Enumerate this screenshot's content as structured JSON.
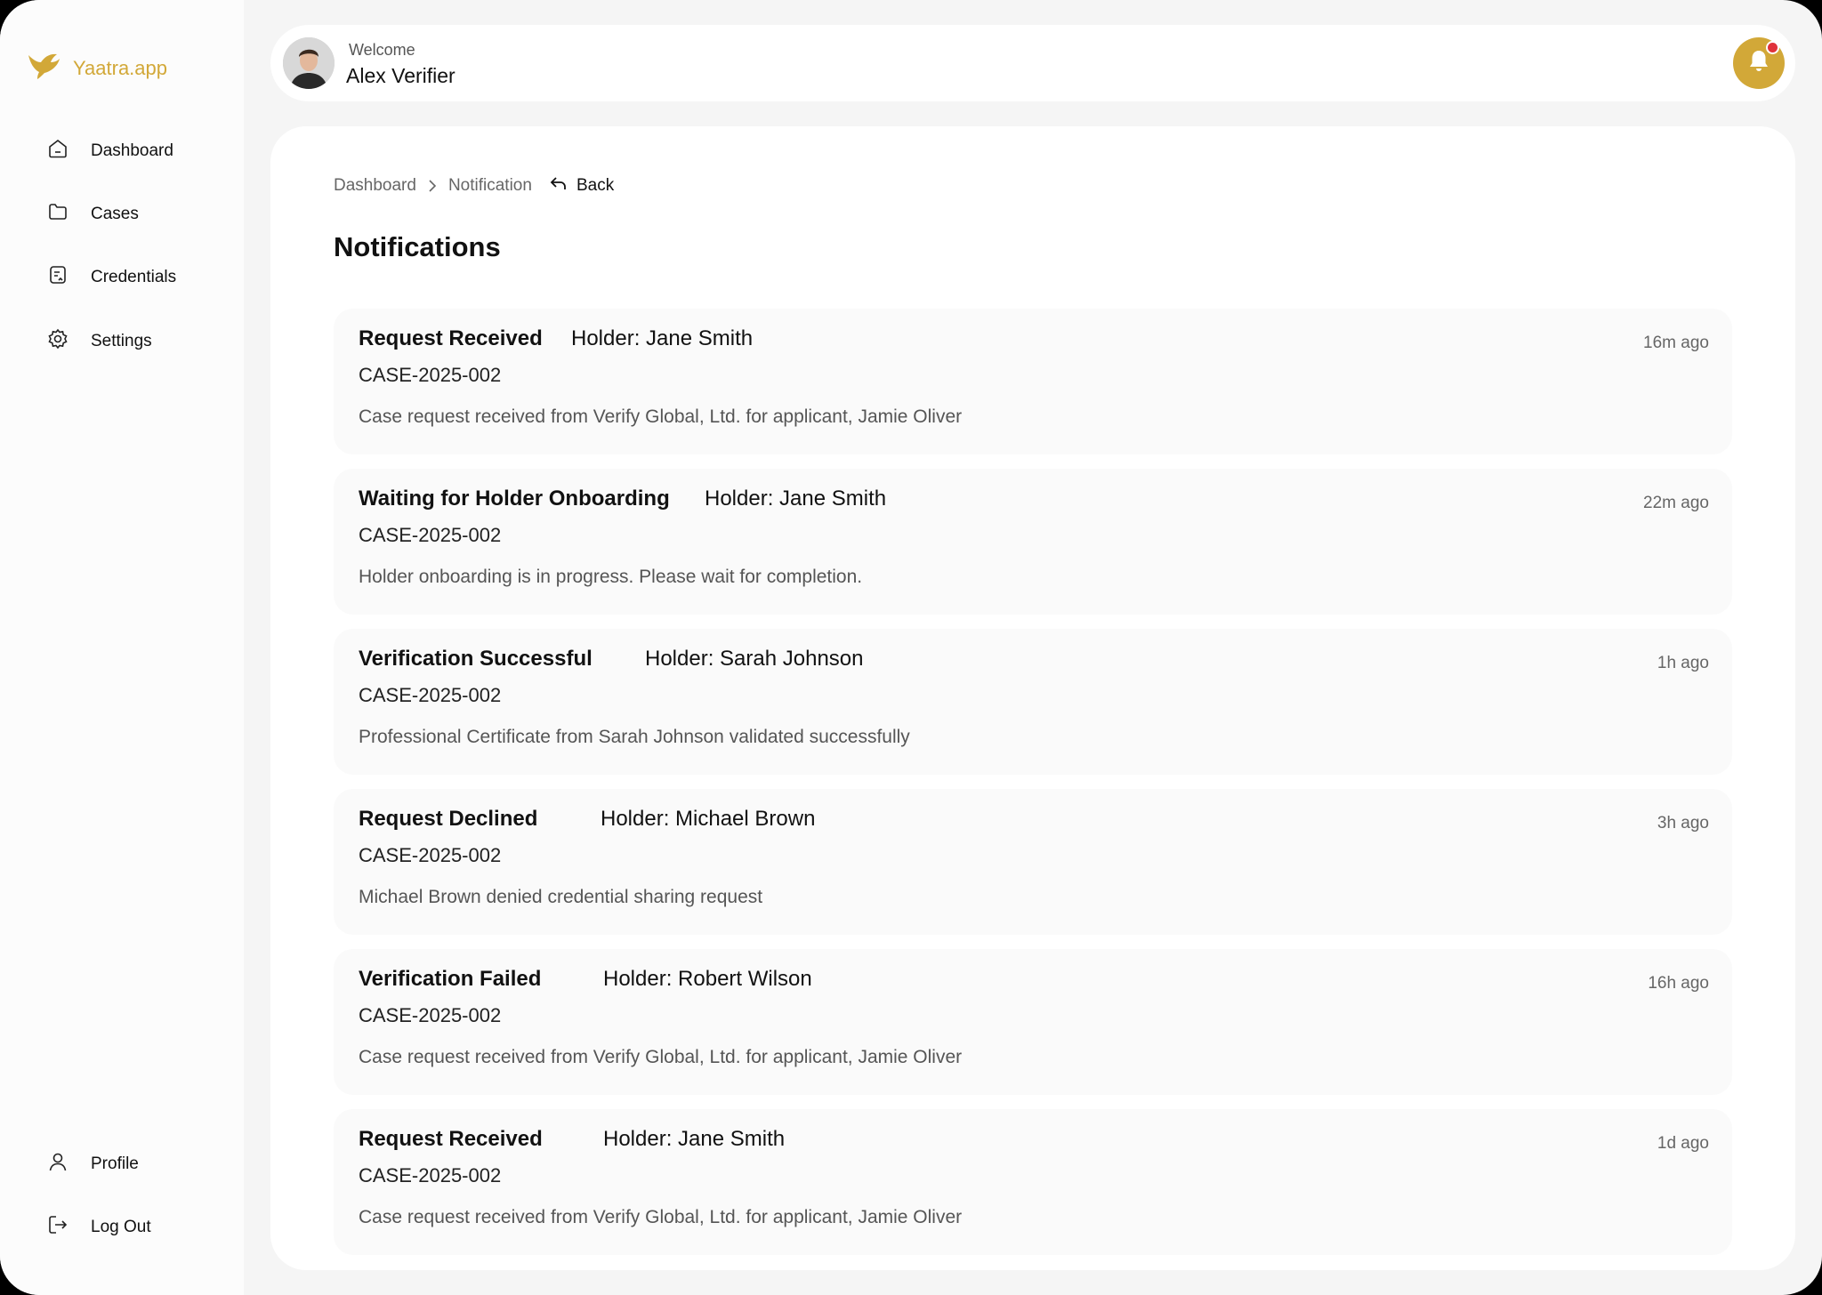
{
  "brand": {
    "name": "Yaatra.app",
    "accent": "#d2a838"
  },
  "sidebar": {
    "items": [
      {
        "label": "Dashboard",
        "icon": "home-icon"
      },
      {
        "label": "Cases",
        "icon": "folder-icon"
      },
      {
        "label": "Credentials",
        "icon": "credential-icon"
      },
      {
        "label": "Settings",
        "icon": "gear-icon"
      }
    ],
    "bottom": [
      {
        "label": "Profile",
        "icon": "user-icon"
      },
      {
        "label": "Log Out",
        "icon": "logout-icon"
      }
    ]
  },
  "header": {
    "welcome": "Welcome",
    "user_name": "Alex Verifier",
    "notification_icon": "bell-icon",
    "badge_color": "#e0323a"
  },
  "breadcrumb": {
    "items": [
      "Dashboard",
      "Notification"
    ],
    "back_label": "Back"
  },
  "page": {
    "title": "Notifications"
  },
  "notifications": [
    {
      "title": "Request Received",
      "holder": "Holder: Jane Smith",
      "case": "CASE-2025-002",
      "description": "Case request received from Verify Global, Ltd. for applicant, Jamie Oliver",
      "time": "16m ago"
    },
    {
      "title": "Waiting for Holder Onboarding",
      "holder": "Holder: Jane Smith",
      "case": "CASE-2025-002",
      "description": "Holder onboarding is in progress. Please wait for completion.",
      "time": "22m ago"
    },
    {
      "title": "Verification Successful",
      "holder": "Holder: Sarah Johnson",
      "case": "CASE-2025-002",
      "description": "Professional Certificate from Sarah Johnson validated successfully",
      "time": "1h ago"
    },
    {
      "title": "Request Declined",
      "holder": "Holder: Michael Brown",
      "case": "CASE-2025-002",
      "description": "Michael Brown denied credential sharing request",
      "time": "3h ago"
    },
    {
      "title": "Verification Failed",
      "holder": "Holder: Robert Wilson",
      "case": "CASE-2025-002",
      "description": "Case request received from Verify Global, Ltd. for applicant, Jamie Oliver",
      "time": "16h ago"
    },
    {
      "title": "Request Received",
      "holder": "Holder: Jane Smith",
      "case": "CASE-2025-002",
      "description": "Case request received from Verify Global, Ltd. for applicant, Jamie Oliver",
      "time": "1d ago"
    }
  ]
}
